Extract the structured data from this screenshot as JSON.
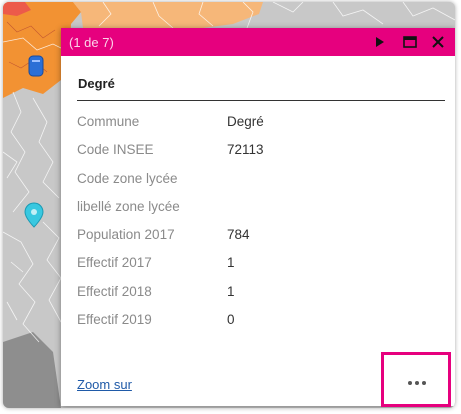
{
  "popup": {
    "counter": "(1 de 7)",
    "title": "Degré",
    "zoom_link": "Zoom sur",
    "attributes": [
      {
        "name": "Commune",
        "value": "Degré"
      },
      {
        "name": "Code INSEE",
        "value": "72113"
      },
      {
        "name": "Code zone lycée",
        "value": ""
      },
      {
        "name": "libellé zone lycée",
        "value": ""
      },
      {
        "name": "Population 2017",
        "value": "784"
      },
      {
        "name": "Effectif 2017",
        "value": "1"
      },
      {
        "name": "Effectif 2018",
        "value": "1"
      },
      {
        "name": "Effectif 2019",
        "value": "0"
      }
    ],
    "header_buttons": [
      "play-icon",
      "maximize-icon",
      "close-icon"
    ],
    "more_button_icon": "ellipsis-icon"
  },
  "colors": {
    "accent": "#e6007e",
    "map_gray": "#c7c7c7",
    "map_orange": "#f28c28",
    "link": "#1f5aa8"
  }
}
